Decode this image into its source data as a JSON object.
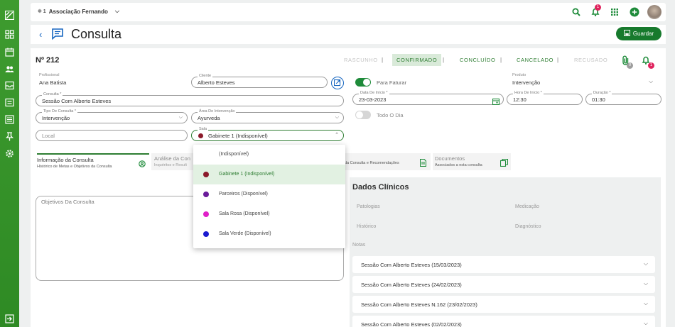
{
  "sidebar": {
    "icons": [
      "logo-icon",
      "dashboard-icon",
      "calendar-icon",
      "users-icon",
      "inbox-icon",
      "clipboard-icon",
      "list-icon",
      "pin-icon",
      "gear-icon",
      "logout-icon"
    ]
  },
  "topbar": {
    "org_name": "Associação Fernando",
    "notif_count": "1",
    "avatar_name": "avatar"
  },
  "header": {
    "title": "Consulta",
    "save_label": "Guardar"
  },
  "form": {
    "number": "Nº 212",
    "statuses": [
      "RASCUNHO",
      "CONFIRMADO",
      "CONCLUÍDO",
      "CANCELADO",
      "RECUSADO"
    ],
    "attachments_count": "0",
    "alerts_count": "1",
    "profissional_label": "Profissional",
    "profissional_value": "Ana Batista",
    "cliente_label": "Cliente",
    "cliente_value": "Alberto Esteves",
    "faturar_label": "Para Faturar",
    "produto_label": "Produto",
    "produto_value": "Intervenção",
    "consulta_label": "Consulta *",
    "consulta_value": "Sessão Com Alberto Esteves",
    "data_label": "Data De Início *",
    "data_value": "23-03-2023",
    "hora_label": "Hora De Início *",
    "hora_value": "12:30",
    "duracao_label": "Duração *",
    "duracao_value": "01:30",
    "tipo_label": "Tipo De Consulta *",
    "tipo_value": "Intervenção",
    "area_label": "Área De Intervenção",
    "area_value": "Ayurveda",
    "todo_dia_label": "Todo O Dia",
    "local_placeholder": "Local",
    "sala_label": "Sala",
    "sala_value": "Gabinete 1 (Indisponível)",
    "sala_dot_color": "#8b1a2b"
  },
  "tabs": [
    {
      "title": "Informação da Consulta",
      "subtitle": "Histórico de Metas e Objetivos da Consulta"
    },
    {
      "title": "Análise da Con",
      "subtitle": "Inquéritos e Result"
    },
    {
      "title": "",
      "subtitle": "da Consulta e Recomendações"
    },
    {
      "title": "Documentos",
      "subtitle": "Associados a esta consulta"
    }
  ],
  "dropdown": {
    "options": [
      {
        "label": "(Indisponível)",
        "color": ""
      },
      {
        "label": "Gabinete 1 (Indisponível)",
        "color": "#8b1a2b"
      },
      {
        "label": "Parceiros (Disponível)",
        "color": "#6a1b9a"
      },
      {
        "label": "Sala Rosa (Disponível)",
        "color": "#e020c8"
      },
      {
        "label": "Sala Verde (Disponível)",
        "color": "#1a1ad0"
      }
    ]
  },
  "notes": {
    "placeholder": "Objetivos Da Consulta"
  },
  "clinical": {
    "title": "Dados Clínicos",
    "patologias": "Patologias",
    "medicacao": "Medicação",
    "historico": "Histórico",
    "diagnostico": "Diagnóstico",
    "notas": "Notas",
    "sessions": [
      "Sessão Com Alberto Esteves (15/03/2023)",
      "Sessão Com Alberto Esteves (24/02/2023)",
      "Sessão Com Alberto Esteves N.162 (23/02/2023)",
      "Sessão Com Alberto Esteves (02/02/2023)"
    ]
  }
}
